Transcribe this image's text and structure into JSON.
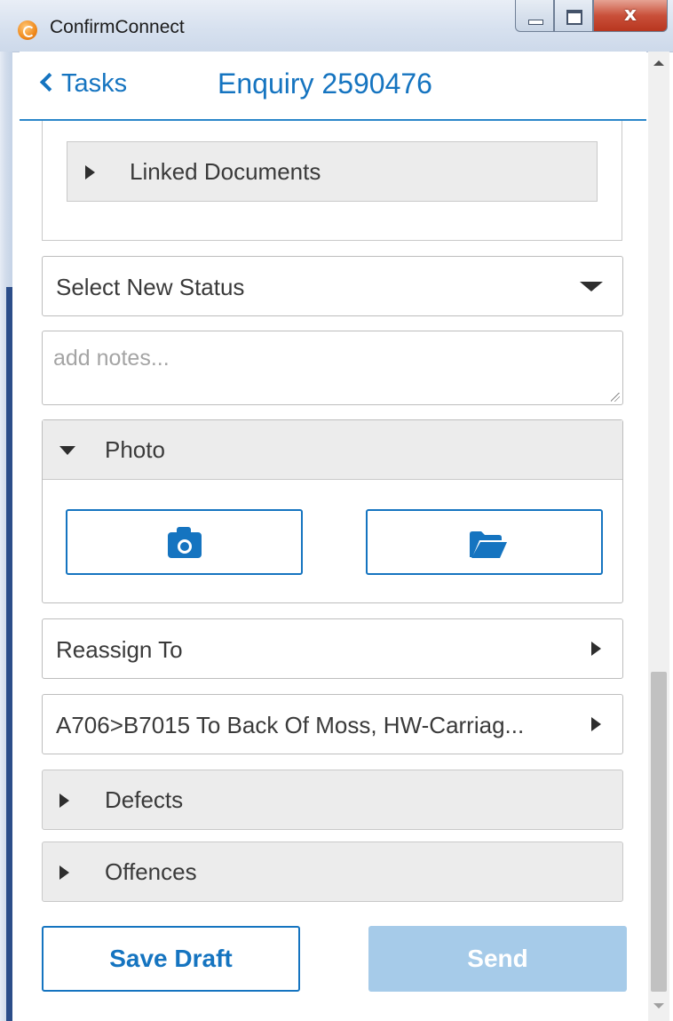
{
  "window": {
    "title": "ConfirmConnect",
    "close_glyph": "x"
  },
  "header": {
    "back_label": "Tasks",
    "title": "Enquiry 2590476"
  },
  "linked_documents": {
    "label": "Linked Documents"
  },
  "status_select": {
    "value": "Select New Status"
  },
  "notes": {
    "placeholder": "add notes...",
    "value": ""
  },
  "photo": {
    "label": "Photo",
    "camera_icon": "camera-icon",
    "folder_icon": "folder-open-icon"
  },
  "reassign": {
    "label": "Reassign To"
  },
  "location": {
    "label": "A706>B7015 To Back Of Moss, HW-Carriag..."
  },
  "defects": {
    "label": "Defects"
  },
  "offences": {
    "label": "Offences"
  },
  "actions": {
    "save_draft": "Save Draft",
    "send": "Send"
  },
  "colors": {
    "accent": "#1574c0",
    "send_disabled": "#a6cbe9",
    "panel_bg": "#ececec"
  }
}
